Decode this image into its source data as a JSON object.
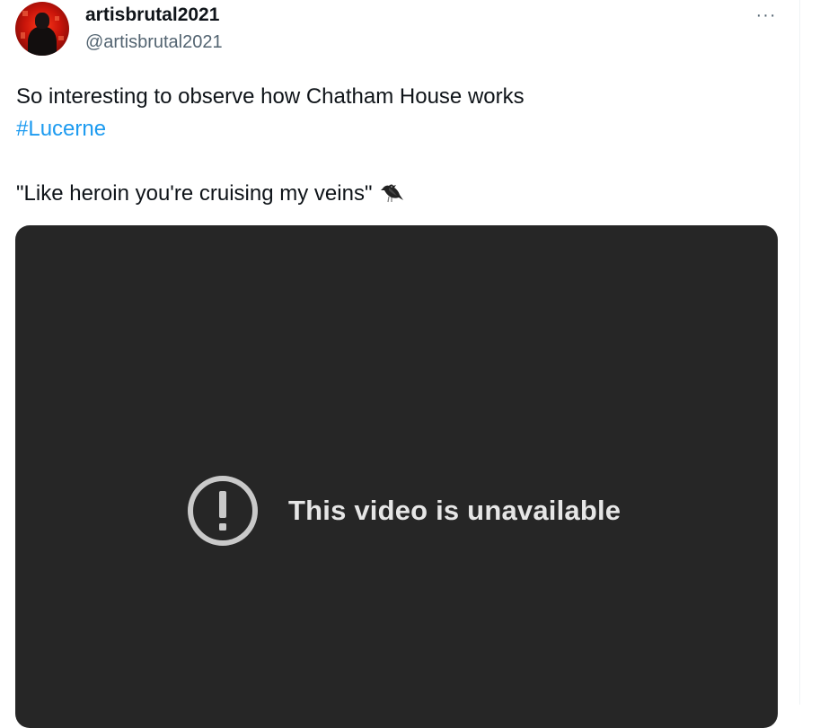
{
  "author": {
    "display_name": "artisbrutal2021",
    "handle": "@artisbrutal2021",
    "avatar_icon": "user-avatar-red-figure"
  },
  "menu": {
    "more_label": "···",
    "more_icon": "more-horizontal-icon"
  },
  "tweet": {
    "line1": "So interesting to observe how Chatham House works",
    "hashtag": "#Lucerne",
    "line3": "\"Like heroin you're cruising my veins\"",
    "emoji_icon": "black-bird-icon"
  },
  "video": {
    "status_icon": "alert-circle-icon",
    "status_text": "This video is unavailable",
    "background_color": "#262626",
    "text_color": "#e6e6e6"
  },
  "colors": {
    "link": "#1d9bf0",
    "secondary_text": "#536471",
    "primary_text": "#0f1419"
  }
}
